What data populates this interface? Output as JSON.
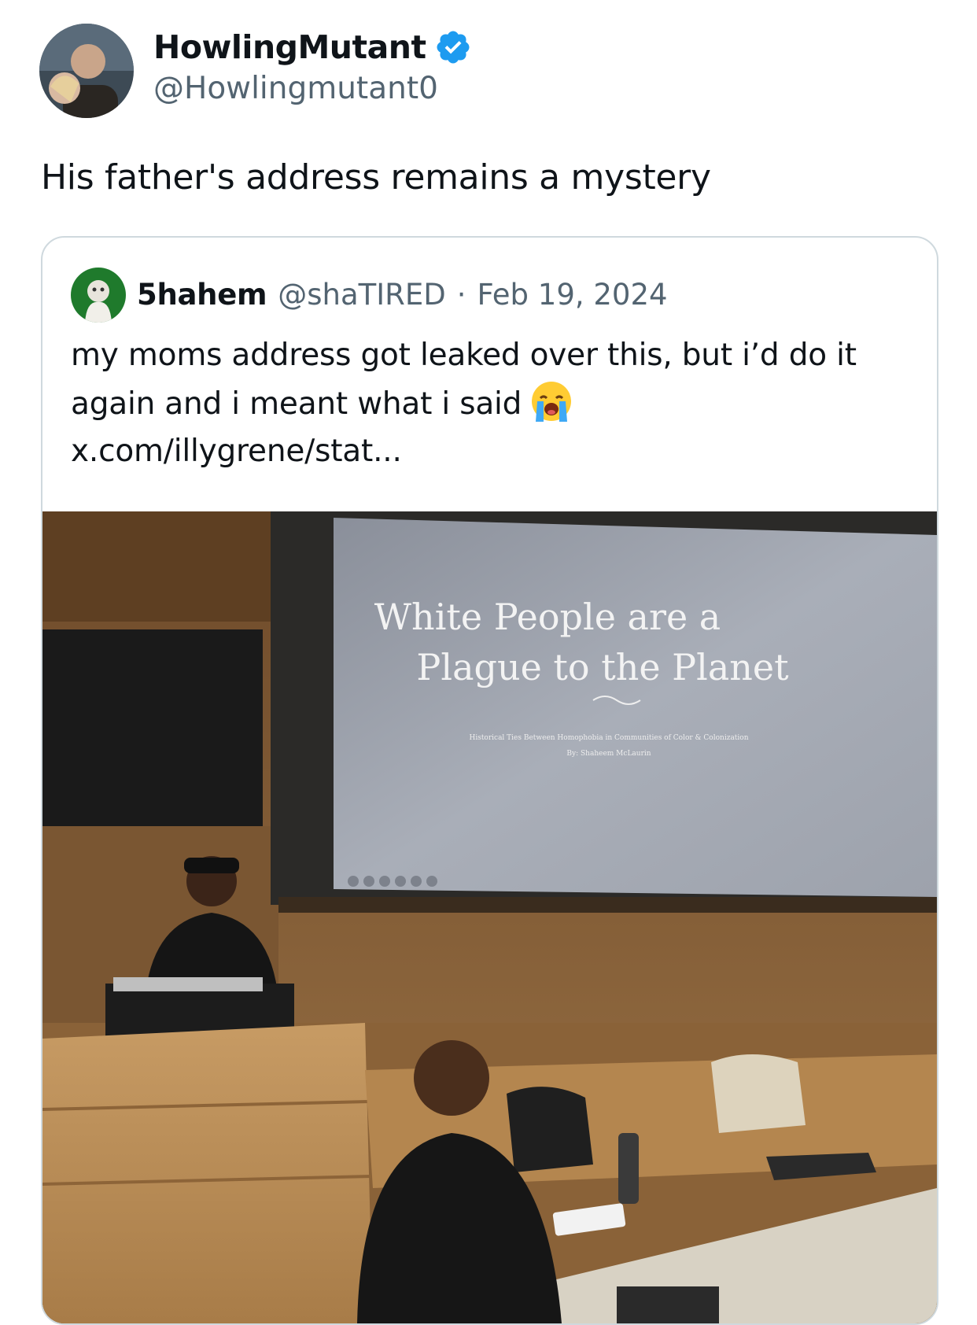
{
  "author": {
    "display_name": "HowlingMutant",
    "handle": "@Howlingmutant0",
    "verified_icon": "verified-badge-icon",
    "verified_color": "#1d9bf0"
  },
  "post": {
    "text": "His father's address remains a mystery"
  },
  "quoted_post": {
    "display_name": "5hahem",
    "handle": "@shaTIRED",
    "separator": "·",
    "date": "Feb 19, 2024",
    "text": "my moms address got leaked over this, but i’d do it again and i meant what i said",
    "emoji": "loudly-crying-face-icon",
    "link": "x.com/illygrene/stat...",
    "media": {
      "slide_title_line1": "White People are a",
      "slide_title_line2": "Plague to the Planet",
      "slide_subtitle": "Historical Ties Between Homophobia in Communities of Color & Colonization",
      "slide_byline": "By: Shaheem McLaurin"
    }
  }
}
